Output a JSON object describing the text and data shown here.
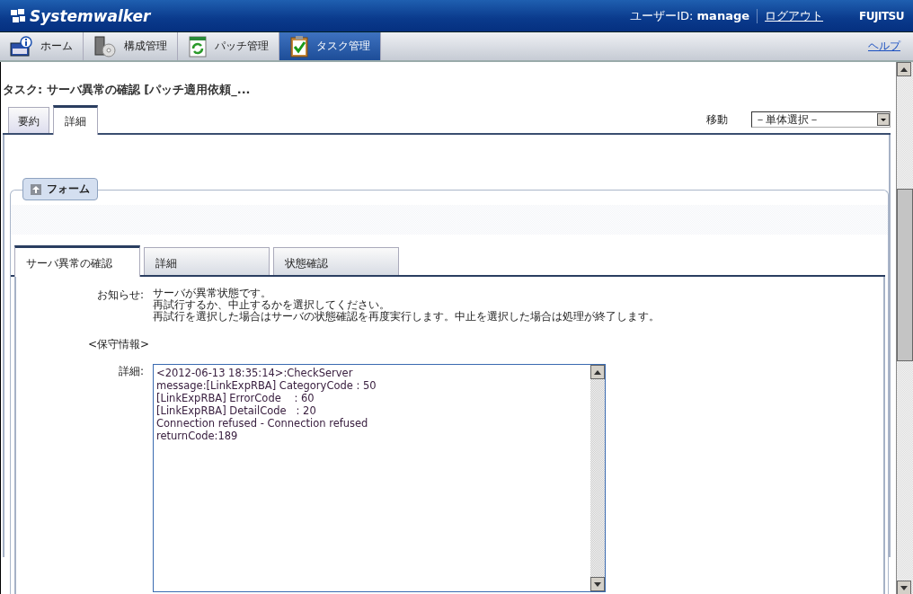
{
  "header": {
    "logo": "Systemwalker",
    "user_label": "ユーザーID:",
    "user_id": "manage",
    "logout": "ログアウト",
    "brand": "FUJITSU"
  },
  "nav": {
    "items": [
      {
        "label": "ホーム",
        "selected": false
      },
      {
        "label": "構成管理",
        "selected": false
      },
      {
        "label": "パッチ管理",
        "selected": false
      },
      {
        "label": "タスク管理",
        "selected": true
      }
    ],
    "help": "ヘルプ"
  },
  "page_title": "タスク: サーバ異常の確認 [パッチ適用依頼_...",
  "tabs": [
    {
      "label": "要約",
      "selected": false
    },
    {
      "label": "詳細",
      "selected": true
    }
  ],
  "move": {
    "label": "移動",
    "value": "－単体選択－"
  },
  "form": {
    "title": "フォーム",
    "tabs": [
      {
        "label": "サーバ異常の確認",
        "selected": true
      },
      {
        "label": "詳細",
        "selected": false
      },
      {
        "label": "状態確認",
        "selected": false
      }
    ],
    "notice_label": "お知らせ:",
    "notice_lines": [
      "サーバが異常状態です。",
      "再試行するか、中止するかを選択してください。",
      "再試行を選択した場合はサーバの状態確認を再度実行します。中止を選択した場合は処理が終了します。"
    ],
    "section": "<保守情報>",
    "detail_label": "詳細:",
    "detail_lines": [
      "<2012-06-13 18:35:14>:CheckServer",
      "message:[LinkExpRBA] CategoryCode : 50",
      "[LinkExpRBA] ErrorCode    : 60",
      "[LinkExpRBA] DetailCode   : 20",
      "Connection refused - Connection refused",
      "returnCode:189"
    ]
  }
}
